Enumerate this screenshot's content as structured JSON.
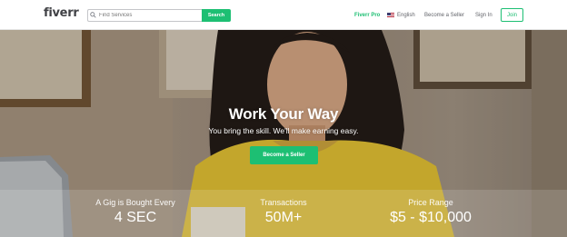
{
  "header": {
    "logo": "fiverr",
    "search": {
      "placeholder": "Find Services",
      "button_label": "Search"
    },
    "nav": {
      "pro": "Fiverr Pro",
      "language": "English",
      "become_seller": "Become a Seller",
      "sign_in": "Sign In",
      "join": "Join"
    }
  },
  "hero": {
    "title": "Work Your Way",
    "subtitle": "You bring the skill. We'll make earning easy.",
    "cta_label": "Become a Seller"
  },
  "stats": [
    {
      "label": "A Gig is Bought Every",
      "value": "4 SEC"
    },
    {
      "label": "Transactions",
      "value": "50M+"
    },
    {
      "label": "Price Range",
      "value": "$5 - $10,000"
    }
  ],
  "colors": {
    "brand_green": "#1dbf73",
    "text_dark": "#404145",
    "text_gray": "#62646a"
  },
  "icons": {
    "search": "search-icon",
    "flag": "us-flag-icon"
  }
}
